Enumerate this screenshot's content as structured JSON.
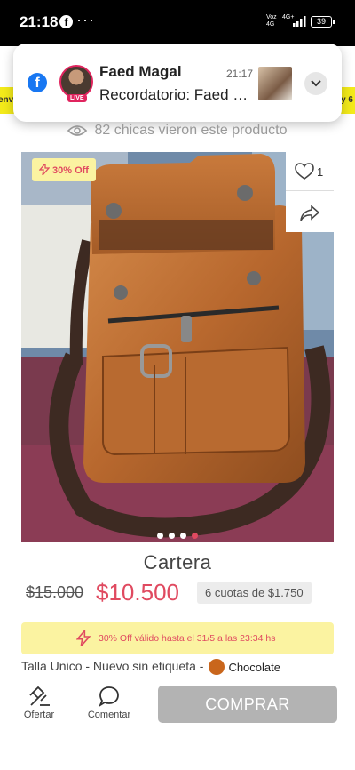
{
  "status_bar": {
    "time": "21:18",
    "facebook_glyph": "f",
    "more_glyph": "···",
    "network_1": "Voz\n4G",
    "network_2": "4G+",
    "battery": "39"
  },
  "promo_strip": {
    "left_text": "envi",
    "right_text": "y 6"
  },
  "notification": {
    "app_icon": "facebook-icon",
    "sender": "Faed Magal",
    "time": "21:17",
    "live_label": "LIVE",
    "message": "Recordatorio: Faed Magal",
    "expand_icon": "chevron-down-icon"
  },
  "views": {
    "text": "82 chicas vieron este producto",
    "icon": "eye-icon"
  },
  "product": {
    "discount_badge": "30% Off",
    "likes": "1",
    "slides_total": 4,
    "active_slide": 4,
    "title": "Cartera",
    "old_price": "$15.000",
    "price": "$10.500",
    "installments": "6 cuotas de $1.750",
    "offer_text": "30% Off válido hasta el 31/5 a las 23:34 hs",
    "specs": "Talla Unico - Nuevo sin etiqueta -",
    "color_name": "Chocolate",
    "color_hex": "#c9661c"
  },
  "bottom_bar": {
    "offer_label": "Ofertar",
    "comment_label": "Comentar",
    "buy_label": "COMPRAR"
  },
  "colors": {
    "accent": "#e04a60",
    "badge_bg": "#fbf3a1",
    "disabled_button": "#b3b3b3",
    "facebook_blue": "#1877f2"
  }
}
